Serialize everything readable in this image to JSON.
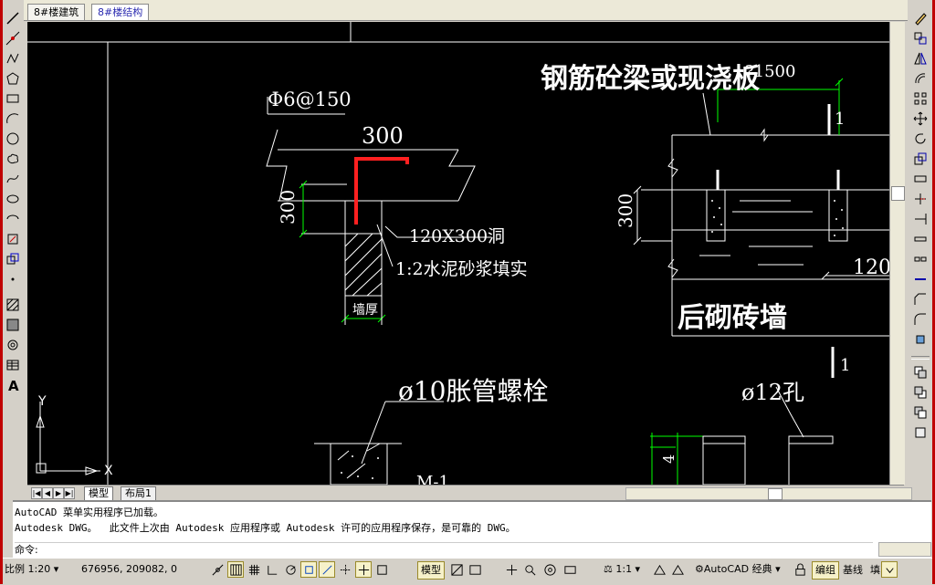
{
  "doc_tabs": [
    {
      "label": "8#楼建筑",
      "active": false
    },
    {
      "label": "8#楼结构",
      "active": true
    }
  ],
  "drawing": {
    "rebar_label": "Φ6@150",
    "dim_300_top": "300",
    "dim_300_left": "300",
    "hole_label": "120X300洞",
    "fill_label": "1:2水泥砂浆填实",
    "wall_thickness": "墙厚",
    "beam_label": "钢筋砼梁或现浇板",
    "spacing_label": "?1500",
    "dim_300_right": "300",
    "dim_120": "120",
    "brick_wall": "后砌砖墙",
    "mark_1_top": "1",
    "mark_1_bottom": "1",
    "bolt_label": "ø10胀管螺栓",
    "hole12_label": "ø12孔",
    "dim_4": "4",
    "m1_label": "M-1",
    "ucs_y": "Y",
    "ucs_x": "X"
  },
  "layout_tabs": [
    {
      "label": "模型",
      "active": true
    },
    {
      "label": "布局1",
      "active": false
    }
  ],
  "command": {
    "line1": "AutoCAD 菜单实用程序已加载。",
    "line2": "Autodesk DWG。  此文件上次由 Autodesk 应用程序或 Autodesk 许可的应用程序保存，是可靠的 DWG。",
    "prompt": "命令:"
  },
  "status": {
    "scale": "比例 1:20",
    "coords": "676956, 209082, 0",
    "model": "模型",
    "annoscale": "1:1",
    "workspace": "AutoCAD 经典",
    "edit_group": "编组",
    "baseline": "基线",
    "fill": "填"
  },
  "colors": {
    "canvas": "#000000",
    "accent_red": "#ff2020",
    "dim_green": "#00ff00",
    "line_white": "#ffffff"
  }
}
